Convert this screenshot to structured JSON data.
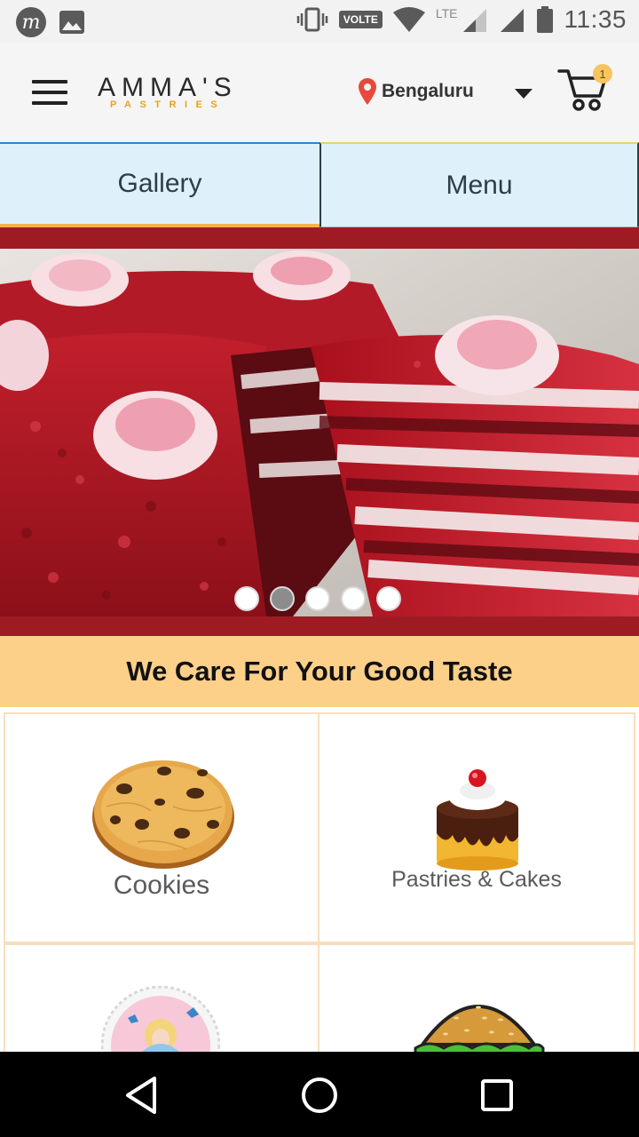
{
  "status_bar": {
    "app_icon_letter": "m",
    "volte_label": "VOLTE",
    "network_label": "LTE",
    "time": "11:35"
  },
  "header": {
    "brand_name": "AMMA'S",
    "brand_sub": "PASTRIES",
    "location": "Bengaluru",
    "cart_count": "1"
  },
  "tabs": [
    {
      "label": "Gallery",
      "selected": true
    },
    {
      "label": "Menu",
      "selected": false
    }
  ],
  "carousel": {
    "slide_count": 5,
    "active_index": 1
  },
  "tagline": "We Care For Your Good Taste",
  "categories": [
    {
      "label": "Cookies",
      "icon": "cookie-icon"
    },
    {
      "label": "Pastries & Cakes",
      "icon": "cake-icon"
    },
    {
      "label": "",
      "icon": "princess-cake-icon"
    },
    {
      "label": "",
      "icon": "burger-icon"
    }
  ],
  "colors": {
    "accent_orange": "#f2b24a",
    "tab_background": "#def1fb",
    "banner_red": "#9e1b24",
    "tagline_background": "#fdd08a",
    "location_pin": "#e8473b"
  }
}
